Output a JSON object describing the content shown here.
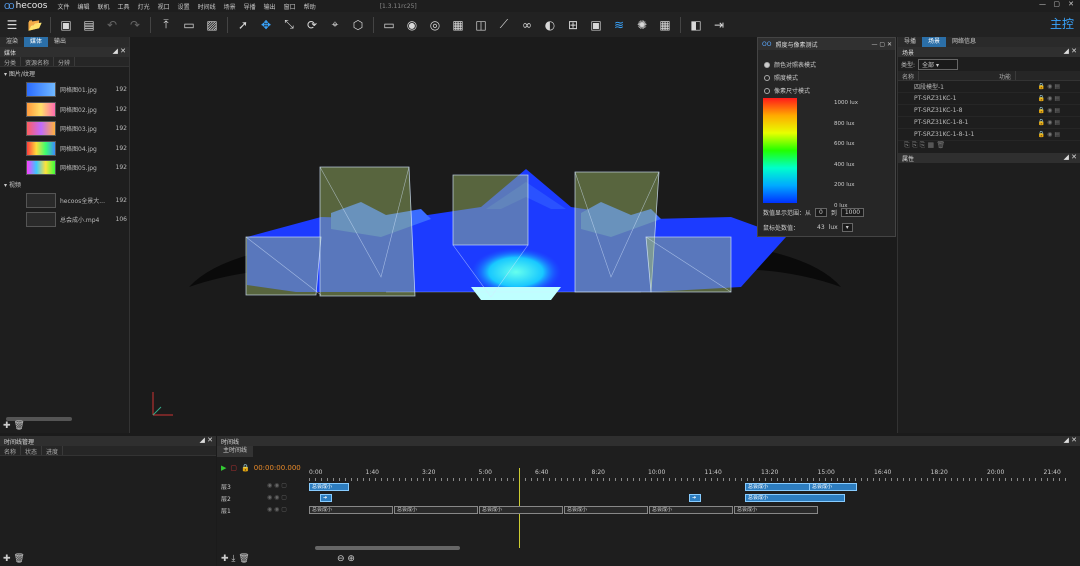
{
  "app": {
    "name": "hecoos",
    "version": "[1.3.11rc25]"
  },
  "menu": [
    "文件",
    "编辑",
    "联机",
    "工具",
    "灯光",
    "视口",
    "设置",
    "时间线",
    "场景",
    "导播",
    "输出",
    "窗口",
    "帮助"
  ],
  "toolbar": {
    "icons": [
      "app-menu-icon",
      "folder-icon",
      "save-icon",
      "save-as-icon",
      "undo-icon",
      "redo-icon",
      "import-icon",
      "frame-icon",
      "image-icon",
      "select-icon",
      "move-icon",
      "scale-icon",
      "rotate-icon",
      "place-icon",
      "cube-icon",
      "monitor-icon",
      "eye-icon",
      "eye-outline-icon",
      "grid-icon",
      "camera-icon",
      "ruler-icon",
      "link-icon",
      "blend-icon",
      "mesh-icon",
      "projector-icon",
      "led-icon",
      "lightbulb-icon",
      "layout-icon",
      "split-icon",
      "exit-icon"
    ],
    "main_label": "主控"
  },
  "left_panel": {
    "tabs": [
      "渲染",
      "媒体",
      "输出"
    ],
    "active_tab": "媒体",
    "title": "媒体",
    "columns": [
      "分类",
      "资源名称",
      "分辨"
    ],
    "groups": [
      {
        "label": "图片/纹理",
        "items": [
          {
            "name": "网格图01.jpg",
            "res": "192"
          },
          {
            "name": "网格图02.jpg",
            "res": "192"
          },
          {
            "name": "网格图03.jpg",
            "res": "192"
          },
          {
            "name": "网格图04.jpg",
            "res": "192"
          },
          {
            "name": "网格图05.jpg",
            "res": "192"
          }
        ]
      },
      {
        "label": "视频",
        "items": [
          {
            "name": "hecoos全景大...",
            "res": "192"
          },
          {
            "name": "总会成小.mp4",
            "res": "106"
          }
        ]
      }
    ]
  },
  "heat_panel": {
    "title": "照度与像素测试",
    "options": [
      "颜色对照表模式",
      "照度模式",
      "像素尺寸模式"
    ],
    "selected": 0,
    "legend": [
      "1000 lux",
      "800 lux",
      "600 lux",
      "400 lux",
      "200 lux",
      "0 lux"
    ],
    "range_label": "数值显示范围：从",
    "range_from": "0",
    "range_to_label": "到",
    "range_to": "1000",
    "current_label": "鼠标处数值：",
    "current_value": "43",
    "current_unit": "lux"
  },
  "right_panel": {
    "tabs": [
      "导播",
      "场景",
      "网络信息"
    ],
    "active_tab": "场景",
    "title": "场景",
    "type_label": "类型:",
    "type_value": "全部",
    "columns": [
      "名称",
      "功能"
    ],
    "items": [
      "四段模型-1",
      "PT-SRZ31KC-1",
      "PT-SRZ31KC-1-8",
      "PT-SRZ31KC-1-8-1",
      "PT-SRZ31KC-1-8-1-1"
    ],
    "props_title": "属性"
  },
  "timeline_manager": {
    "title": "时间线管理",
    "columns": [
      "名称",
      "状态",
      "进度"
    ]
  },
  "timeline": {
    "title": "时间线",
    "subtab": "主时间线",
    "time": "00:00:00.000",
    "ruler": [
      "0:00",
      "1:40",
      "3:20",
      "5:00",
      "6:40",
      "8:20",
      "10:00",
      "11:40",
      "13:20",
      "15:00",
      "16:40",
      "18:20",
      "20:00",
      "21:40"
    ],
    "layers": [
      "层3",
      "层2",
      "层1"
    ],
    "clip_label": "总会成小"
  }
}
